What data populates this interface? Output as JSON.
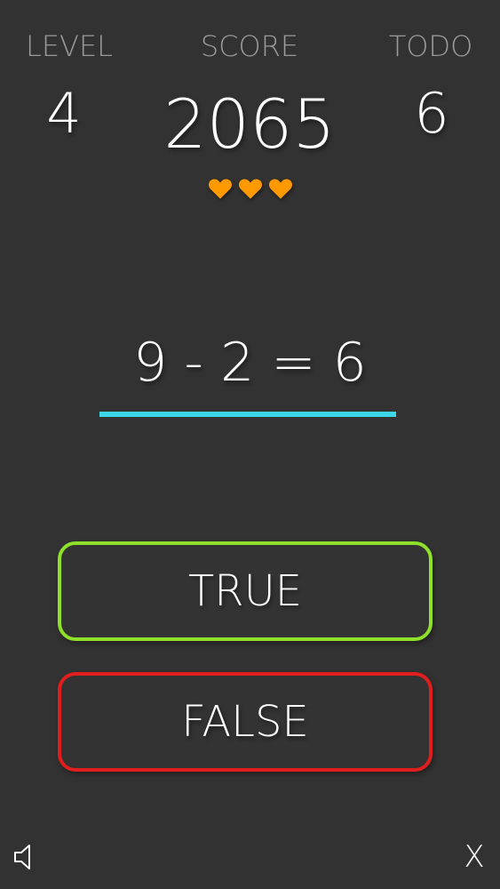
{
  "hud": {
    "level_label": "LEVEL",
    "level_value": "4",
    "score_label": "SCORE",
    "score_value": "2065",
    "todo_label": "TODO",
    "todo_value": "6",
    "lives": 3,
    "heart_color": "#ff9900"
  },
  "question": {
    "equation": "9 - 2 = 6",
    "underline_color": "#3dd6e8"
  },
  "answers": {
    "true_label": "TRUE",
    "true_color": "#8fe02a",
    "false_label": "FALSE",
    "false_color": "#e01e1e"
  },
  "controls": {
    "sound_icon": "speaker-icon",
    "close_label": "X"
  }
}
